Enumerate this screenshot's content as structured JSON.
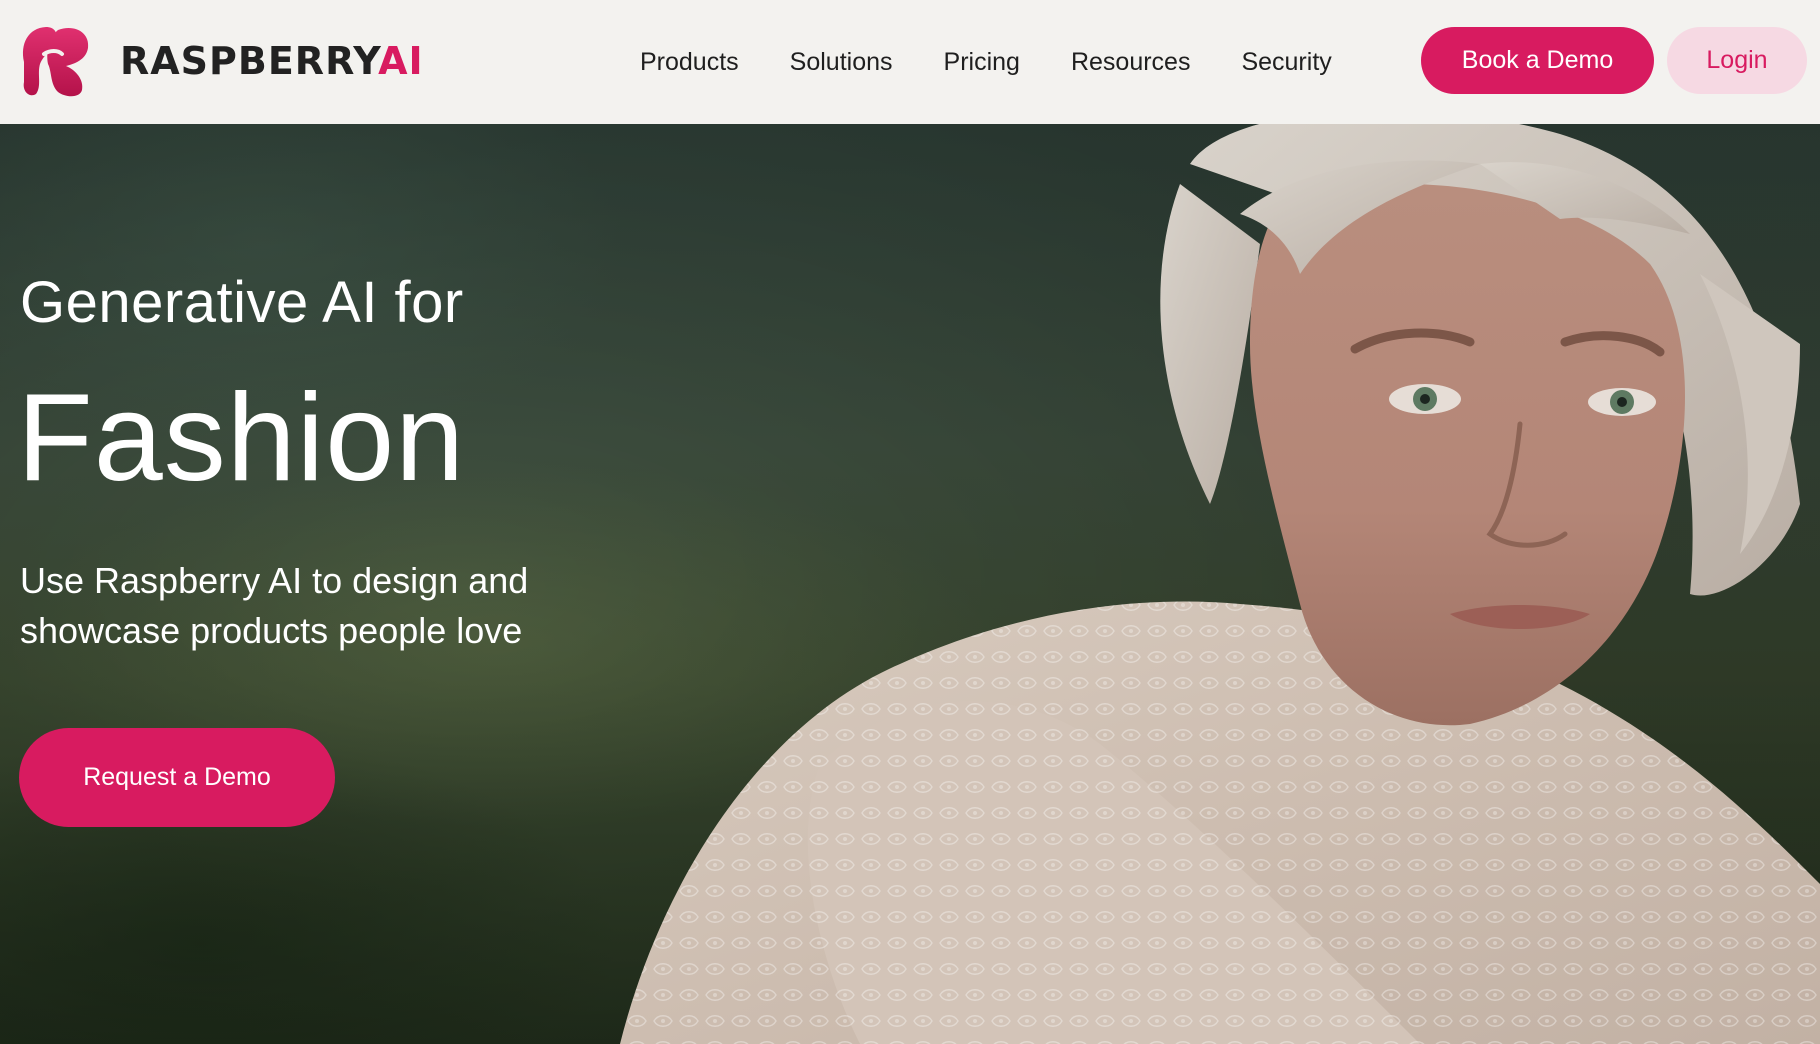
{
  "brand": {
    "name_main": "RASPBERRY",
    "name_accent": "AI",
    "accent_color": "#d81b60",
    "logo_icon": "raspberry-r-logo-icon"
  },
  "nav": {
    "items": [
      {
        "label": "Products"
      },
      {
        "label": "Solutions"
      },
      {
        "label": "Pricing"
      },
      {
        "label": "Resources"
      },
      {
        "label": "Security"
      }
    ],
    "book_demo_label": "Book a Demo",
    "login_label": "Login"
  },
  "hero": {
    "kicker": "Generative AI for",
    "title": "Fashion",
    "subtitle_line1": "Use Raspberry AI to design and",
    "subtitle_line2": "showcase products people love",
    "cta_label": "Request a Demo",
    "image": "photo of a woman with short blonde hair in a white lace blouse against a blurred green hillside"
  },
  "colors": {
    "header_bg": "#f3f2ef",
    "primary": "#d81b60",
    "login_bg": "#f6d9e3",
    "text_dark": "#1f1f1f"
  }
}
